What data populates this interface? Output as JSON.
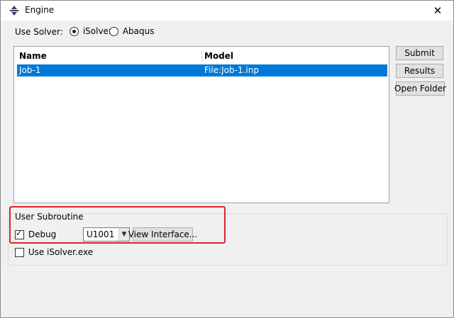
{
  "window": {
    "title": "Engine",
    "close_glyph": "✕",
    "app_icon": "engine-icon"
  },
  "solver": {
    "label": "Use Solver:",
    "options": [
      {
        "label": "iSolver",
        "selected": true
      },
      {
        "label": "Abaqus",
        "selected": false
      }
    ]
  },
  "jobs_table": {
    "columns": [
      "Name",
      "Model"
    ],
    "rows": [
      {
        "name": "Job-1",
        "model": "File:Job-1.inp",
        "selected": true
      }
    ]
  },
  "actions": {
    "submit": "Submit",
    "results": "Results",
    "open_folder": "Open Folder"
  },
  "user_subroutine": {
    "group_label": "User Subroutine",
    "debug_label": "Debug",
    "debug_checked": true,
    "subroutine_value": "U1001",
    "view_interface_label": "View Interface..."
  },
  "use_exe": {
    "label": "Use iSolver.exe",
    "checked": false
  },
  "colors": {
    "selection": "#0078d7",
    "highlight": "#d9262c"
  }
}
